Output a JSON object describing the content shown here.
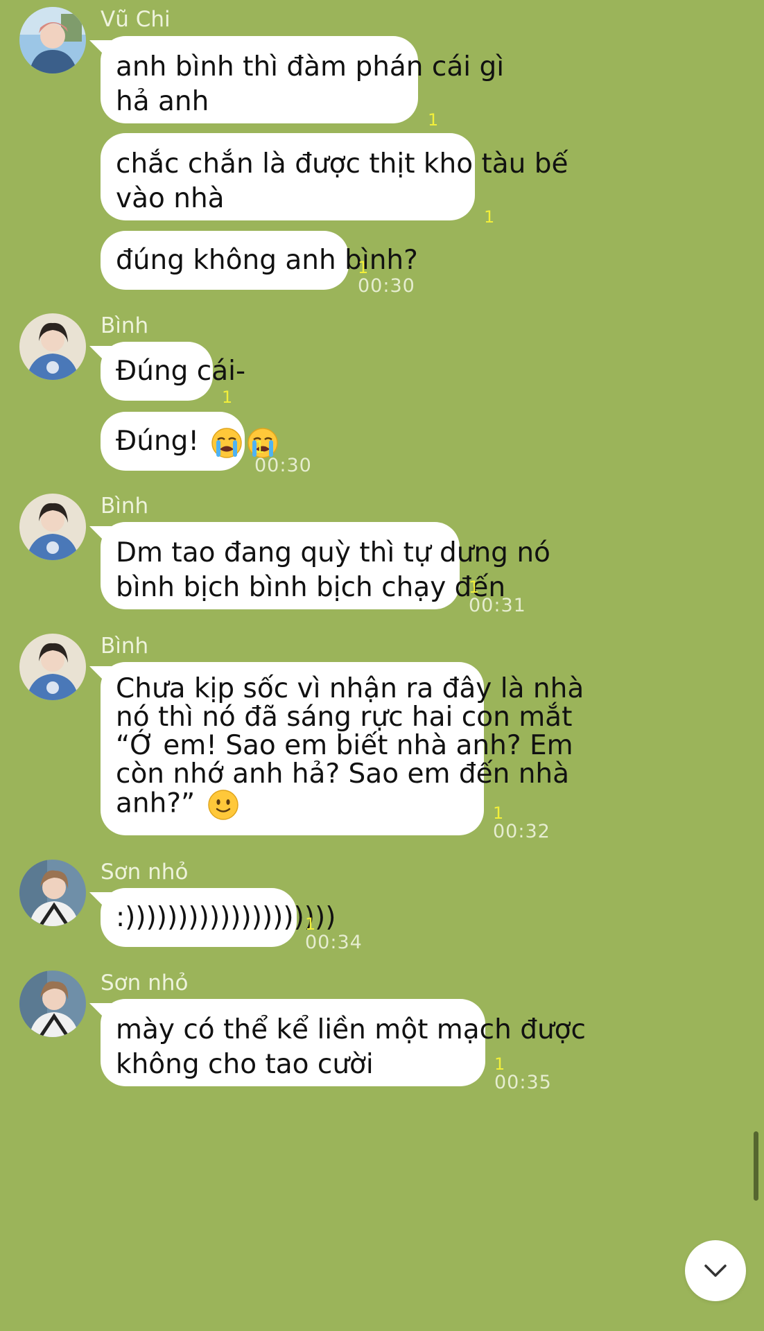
{
  "conversation": {
    "groups": [
      {
        "sender": "Vũ Chi",
        "messages": [
          {
            "lines": [
              "anh bình thì đàm phán cái gì",
              "hả anh"
            ],
            "unread": "1",
            "time": ""
          },
          {
            "lines": [
              "chắc chắn là được thịt kho tàu bế",
              "vào nhà"
            ],
            "unread": "1",
            "time": ""
          },
          {
            "lines": [
              "đúng không anh bình?"
            ],
            "unread": "1",
            "time": "00:30"
          }
        ]
      },
      {
        "sender": "Bình",
        "messages": [
          {
            "lines": [
              "Đúng cái-"
            ],
            "unread": "1",
            "time": ""
          },
          {
            "lines": [
              "Đúng! "
            ],
            "emoji": [
              "crying-face",
              "crying-face"
            ],
            "unread": "1",
            "time": "00:30"
          }
        ]
      },
      {
        "sender": "Bình",
        "messages": [
          {
            "lines": [
              "Dm tao đang quỳ thì tự dưng nó",
              "bình bịch bình bịch chạy đến"
            ],
            "unread": "1",
            "time": "00:31"
          }
        ]
      },
      {
        "sender": "Bình",
        "messages": [
          {
            "lines": [
              "Chưa kịp sốc vì nhận ra đây là nhà",
              "nó thì nó đã sáng rực hai con mắt",
              "“Ớ em! Sao em biết nhà anh? Em",
              "còn nhớ anh hả? Sao em đến nhà",
              "anh?” "
            ],
            "emoji_last_line": [
              "slightly-smiling-face"
            ],
            "unread": "1",
            "time": "00:32"
          }
        ]
      },
      {
        "sender": "Sơn nhỏ",
        "messages": [
          {
            "lines": [
              ":))))))))))))))))))))"
            ],
            "unread": "1",
            "time": "00:34"
          }
        ]
      },
      {
        "sender": "Sơn nhỏ",
        "messages": [
          {
            "lines": [
              "mày có thể kể liền một mạch được",
              "không cho tao cười"
            ],
            "unread": "1",
            "time": "00:35"
          }
        ]
      }
    ]
  },
  "colors": {
    "background": "#9bb45a",
    "bubble": "#ffffff",
    "unread": "#f2ef3a",
    "meta_text": "#e6edd0"
  },
  "icons": {
    "scroll_down": "chevron-down-icon"
  }
}
